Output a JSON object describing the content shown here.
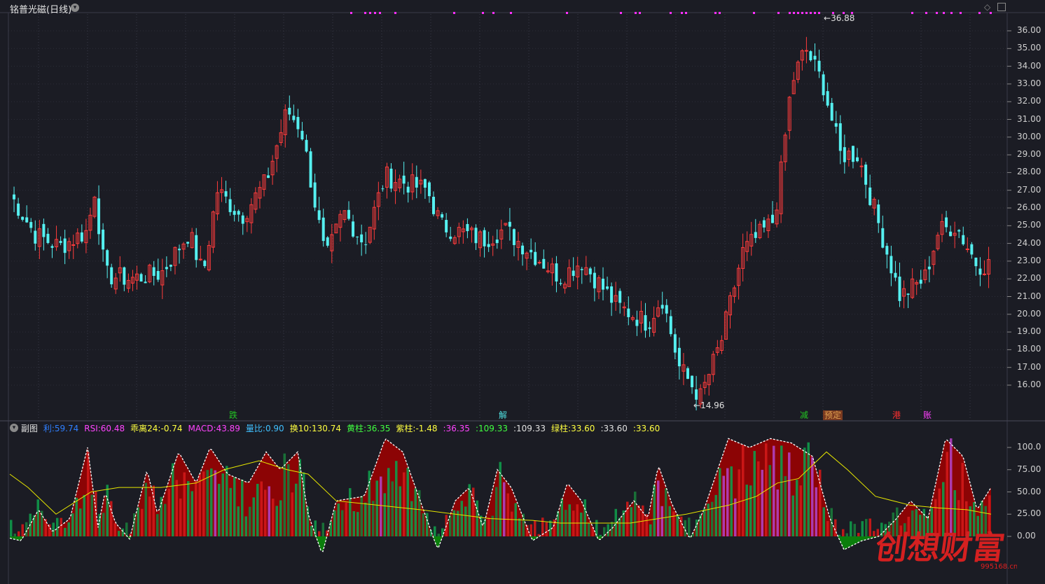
{
  "header": {
    "title": "铭普光磁(日线)",
    "dropdown_icon": "chevron-down-icon",
    "settings_icon": "diamond-icon",
    "window_icon": "window-icon"
  },
  "price_axis": {
    "ticks": [
      "36.00",
      "35.00",
      "34.00",
      "33.00",
      "32.00",
      "31.00",
      "30.00",
      "29.00",
      "28.00",
      "27.00",
      "26.00",
      "25.00",
      "24.00",
      "23.00",
      "22.00",
      "21.00",
      "20.00",
      "19.00",
      "18.00",
      "17.00",
      "16.00"
    ]
  },
  "markers": {
    "high": "36.88",
    "low": "14.96"
  },
  "signals": [
    {
      "text": "跌",
      "color": "#22c422"
    },
    {
      "text": "解",
      "color": "#4fe0e0"
    },
    {
      "text": "减",
      "color": "#22c422"
    },
    {
      "text": "预定",
      "color": "#e0a050"
    },
    {
      "text": "港",
      "color": "#ff3030"
    },
    {
      "text": "账",
      "color": "#ff40ff"
    }
  ],
  "sub_panel": {
    "name": "副图",
    "stats": [
      {
        "label": "利:",
        "value": "59.74",
        "color": "#2f7fff"
      },
      {
        "label": "RSI:",
        "value": "60.48",
        "color": "#ff44ff"
      },
      {
        "label": "乖离24:",
        "value": "-0.74",
        "color": "#ffff40"
      },
      {
        "label": "MACD:",
        "value": "43.89",
        "color": "#ff44ff"
      },
      {
        "label": "量比:",
        "value": "0.90",
        "color": "#40c0ff"
      },
      {
        "label": "换10:",
        "value": "130.74",
        "color": "#ffff40"
      },
      {
        "label": "黄柱:",
        "value": "36.35",
        "color": "#40ff40"
      },
      {
        "label": "紫柱:",
        "value": "-1.48",
        "color": "#ffff40"
      },
      {
        "label": ":",
        "value": "36.35",
        "color": "#ff44ff"
      },
      {
        "label": ":",
        "value": "109.33",
        "color": "#40ff40"
      },
      {
        "label": ":",
        "value": "109.33",
        "color": "#e0e0e0"
      },
      {
        "label": "绿柱:",
        "value": "33.60",
        "color": "#ffff40"
      },
      {
        "label": ":",
        "value": "33.60",
        "color": "#e0e0e0"
      },
      {
        "label": ":",
        "value": "33.60",
        "color": "#ffff40"
      }
    ],
    "ticks": [
      "100.0",
      "75.00",
      "50.00",
      "25.00",
      "0.00"
    ]
  },
  "watermark": {
    "text": "创想财富",
    "url": "995168.cn"
  },
  "colors": {
    "up": "#ff3c3c",
    "down": "#55f0f0",
    "background": "#1b1c24",
    "grid": "#3a3a48"
  }
}
